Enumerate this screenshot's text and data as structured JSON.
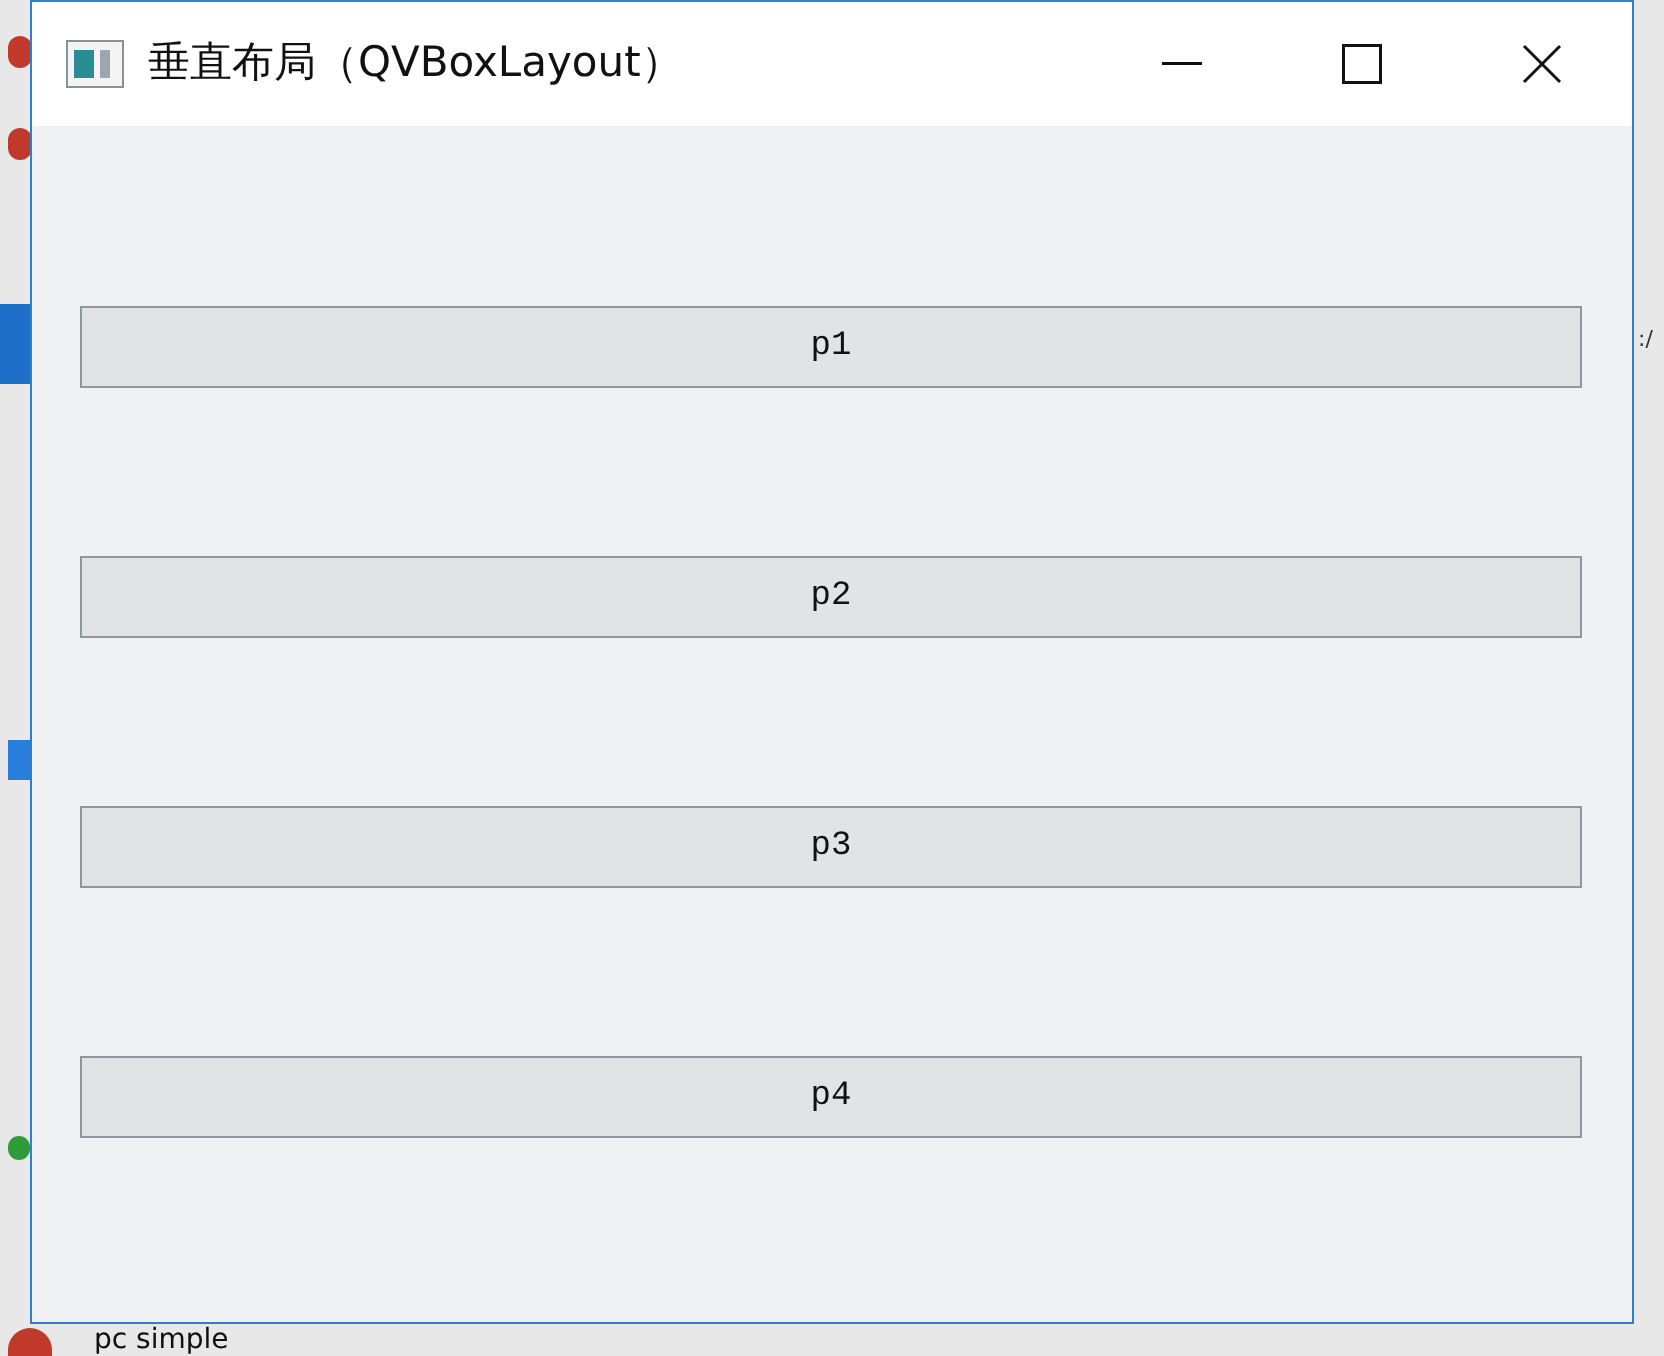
{
  "window": {
    "title": "垂直布局（QVBoxLayout）"
  },
  "buttons": [
    {
      "label": "p1"
    },
    {
      "label": "p2"
    },
    {
      "label": "p3"
    },
    {
      "label": "p4"
    }
  ],
  "background": {
    "right_text": ":/",
    "bottom_text": "pc simple"
  }
}
